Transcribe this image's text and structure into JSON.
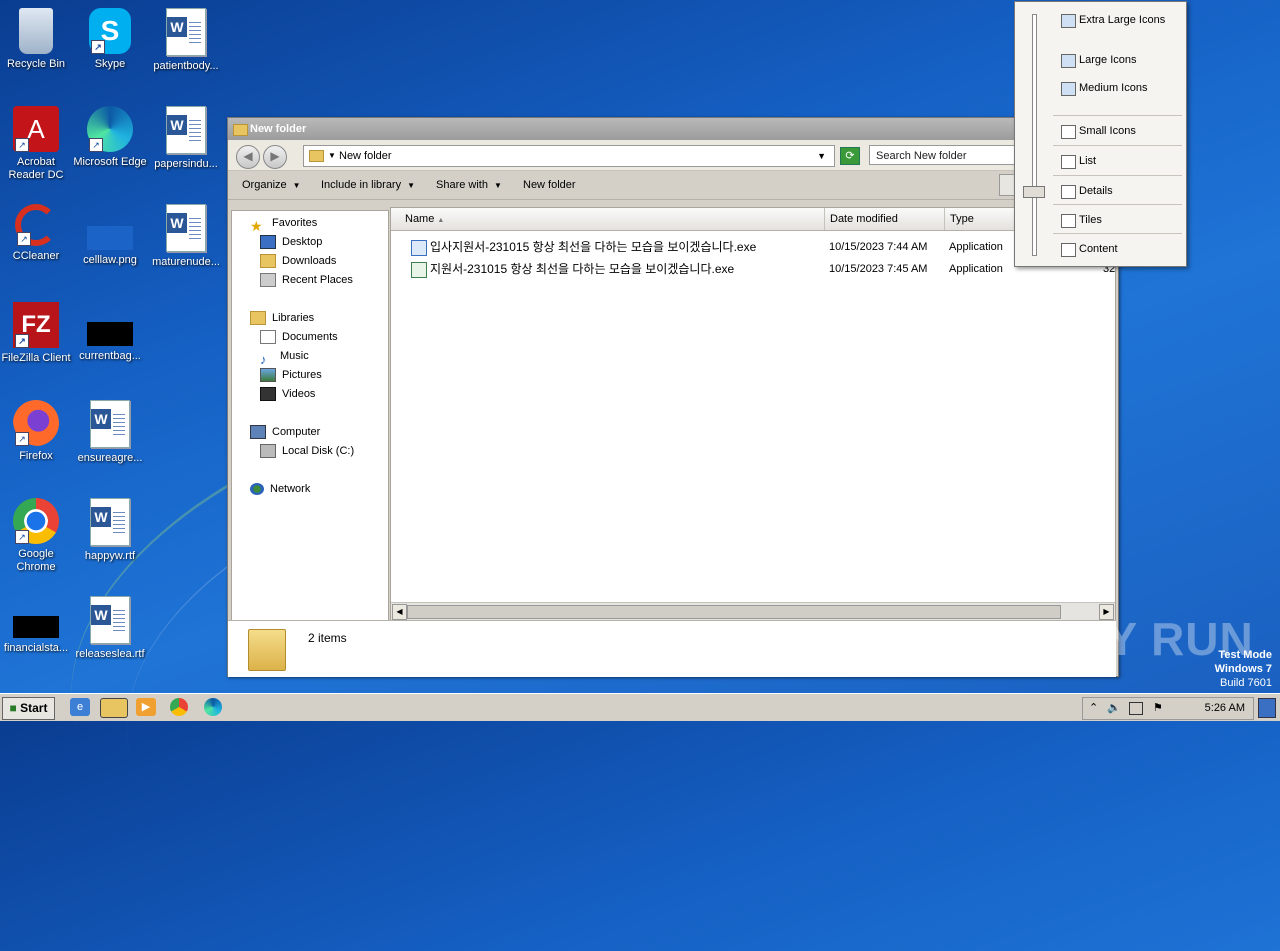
{
  "desktop": {
    "icons": [
      {
        "label": "Recycle Bin"
      },
      {
        "label": "Skype"
      },
      {
        "label": "patientbody..."
      },
      {
        "label": "Acrobat Reader DC"
      },
      {
        "label": "Microsoft Edge"
      },
      {
        "label": "papersindu..."
      },
      {
        "label": "CCleaner"
      },
      {
        "label": "celllaw.png"
      },
      {
        "label": "maturenude..."
      },
      {
        "label": "FileZilla Client"
      },
      {
        "label": "currentbag..."
      },
      {
        "label": "Firefox"
      },
      {
        "label": "ensureagre..."
      },
      {
        "label": "Google Chrome"
      },
      {
        "label": "happyw.rtf"
      },
      {
        "label": "financialsta..."
      },
      {
        "label": "releaseslea.rtf"
      }
    ]
  },
  "window": {
    "title": "New folder",
    "address": "New folder",
    "search_placeholder": "Search New folder",
    "toolbar": {
      "organize": "Organize",
      "include": "Include in library",
      "share": "Share with",
      "newfolder": "New folder"
    },
    "nav": {
      "favorites": "Favorites",
      "desktop": "Desktop",
      "downloads": "Downloads",
      "recent": "Recent Places",
      "libraries": "Libraries",
      "documents": "Documents",
      "music": "Music",
      "pictures": "Pictures",
      "videos": "Videos",
      "computer": "Computer",
      "localdisk": "Local Disk (C:)",
      "network": "Network"
    },
    "columns": {
      "name": "Name",
      "date": "Date modified",
      "type": "Type"
    },
    "files": [
      {
        "name": "입사지원서-231015 항상 최선을 다하는 모습을 보이겠습니다.exe",
        "date": "10/15/2023 7:44 AM",
        "type": "Application"
      },
      {
        "name": "지원서-231015 항상 최선을 다하는 모습을 보이겠습니다.exe",
        "date": "10/15/2023 7:45 AM",
        "type": "Application"
      }
    ],
    "partial_size": "32",
    "status": "2 items"
  },
  "view_menu": {
    "items": [
      {
        "label": "Extra Large Icons"
      },
      {
        "label": "Large Icons"
      },
      {
        "label": "Medium Icons"
      },
      {
        "label": "Small Icons"
      },
      {
        "label": "List"
      },
      {
        "label": "Details"
      },
      {
        "label": "Tiles"
      },
      {
        "label": "Content"
      }
    ]
  },
  "taskbar": {
    "start": "Start",
    "clock": "5:26 AM"
  },
  "watermark": {
    "line1": "Test Mode",
    "line2": "Windows 7",
    "line3": "Build 7601",
    "brand": "ANY RUN"
  }
}
